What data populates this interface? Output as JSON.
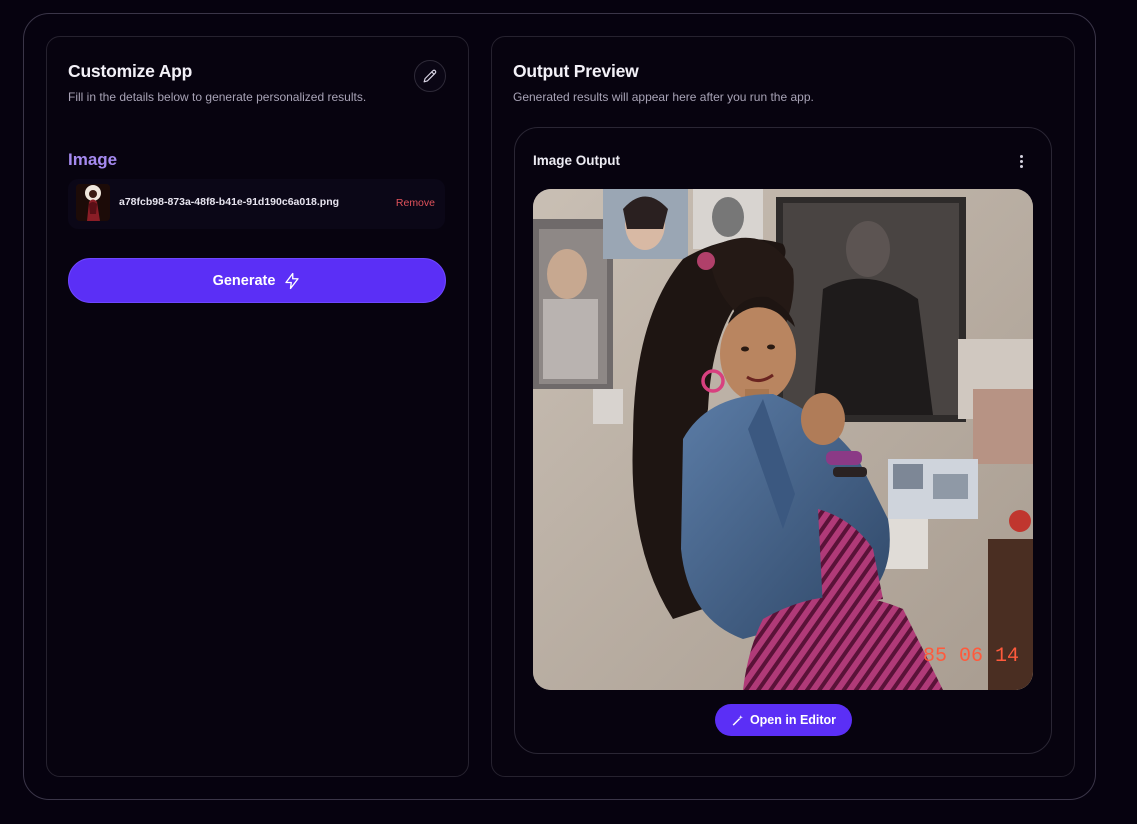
{
  "left_panel": {
    "title": "Customize App",
    "subtitle": "Fill in the details below to generate personalized results.",
    "edit_icon": "pencil-icon",
    "image_section": {
      "label": "Image",
      "file_name": "a78fcb98-873a-48f8-b41e-91d190c6a018.png",
      "remove_label": "Remove"
    },
    "generate": {
      "label": "Generate",
      "icon": "lightning-bolt-icon"
    }
  },
  "right_panel": {
    "title": "Output Preview",
    "subtitle": "Generated results will appear here after you run the app.",
    "output_card": {
      "title": "Image Output",
      "menu_icon": "vertical-ellipsis-icon",
      "date_stamp": "85 06 14",
      "open_editor": {
        "label": "Open in Editor",
        "icon": "wand-icon"
      }
    }
  },
  "colors": {
    "background": "#06020f",
    "accent": "#5b2ff6",
    "section_label": "#a58af0",
    "remove": "#e0525b",
    "date_stamp": "#ff5a3c"
  }
}
